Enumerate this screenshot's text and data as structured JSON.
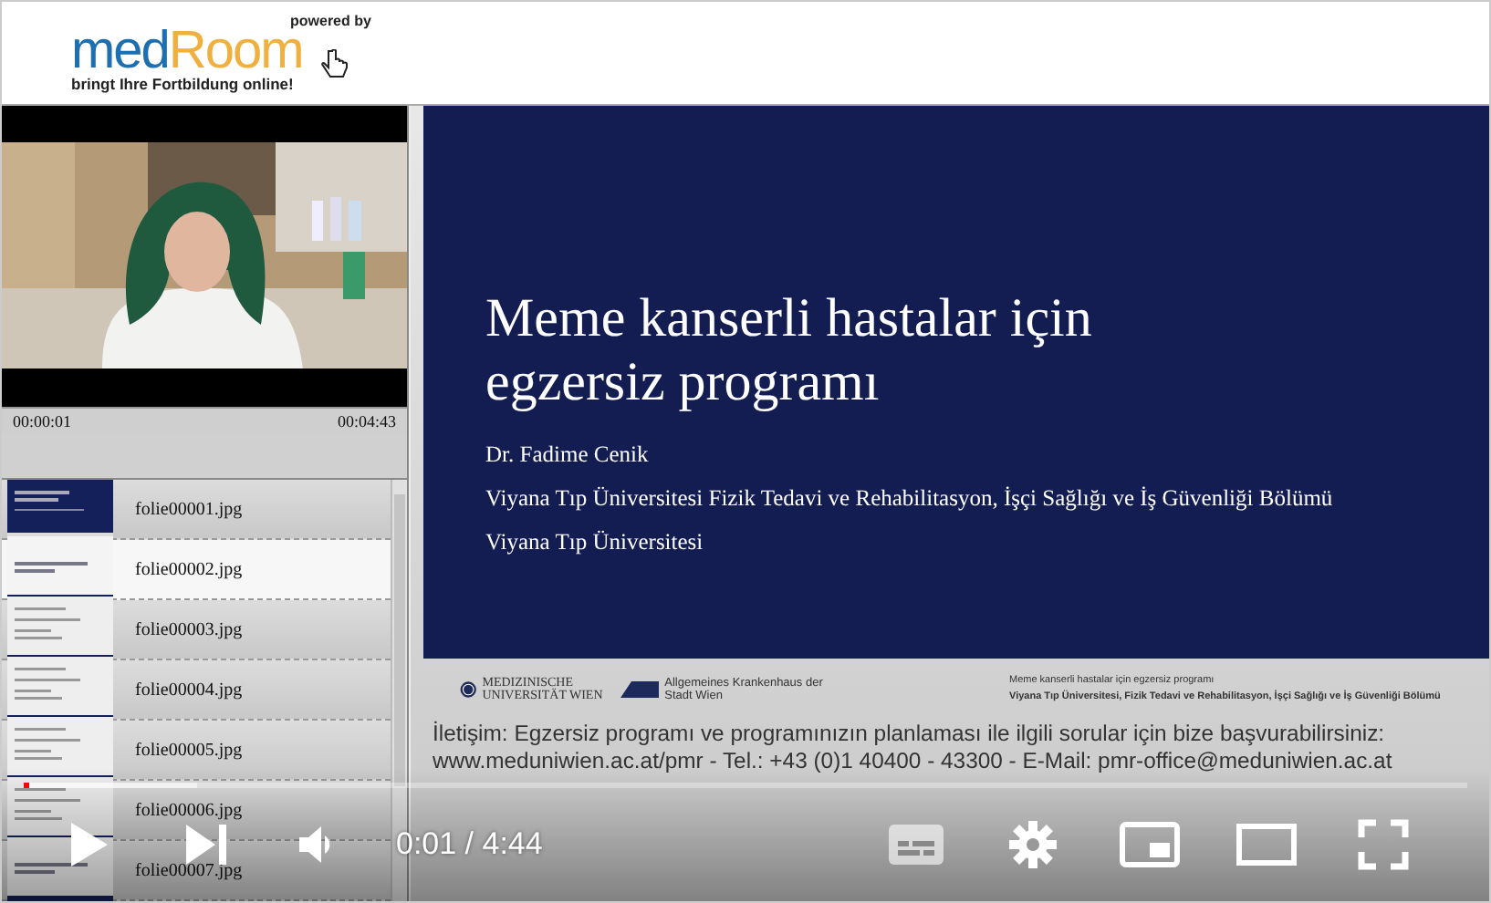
{
  "header": {
    "logo": {
      "brand_a": "med",
      "brand_b": "Room",
      "powered": "powered by",
      "tagline": "bringt Ihre Fortbildung online!"
    }
  },
  "sidebar": {
    "time_start": "00:00:01",
    "time_end": "00:04:43",
    "slides": [
      {
        "label": "folie00001.jpg",
        "selected": false,
        "kind": "title"
      },
      {
        "label": "folie00002.jpg",
        "selected": true,
        "kind": "heading"
      },
      {
        "label": "folie00003.jpg",
        "selected": false,
        "kind": "list"
      },
      {
        "label": "folie00004.jpg",
        "selected": false,
        "kind": "list"
      },
      {
        "label": "folie00005.jpg",
        "selected": false,
        "kind": "list"
      },
      {
        "label": "folie00006.jpg",
        "selected": false,
        "kind": "list"
      },
      {
        "label": "folie00007.jpg",
        "selected": false,
        "kind": "heading"
      }
    ]
  },
  "slide": {
    "title": "Meme kanserli hastalar için egzersiz programı",
    "author": "Dr. Fadime Cenik",
    "department": "Viyana Tıp Üniversitesi Fizik Tedavi ve Rehabilitasyon, İşçi Sağlığı ve İş Güvenliği Bölümü",
    "institution": "Viyana Tıp Üniversitesi",
    "footer": {
      "logo_1": "MEDIZINISCHE UNIVERSITÄT WIEN",
      "logo_2": "Allgemeines Krankenhaus der Stadt Wien",
      "caption_1": "Meme kanserli hastalar için egzersiz programı",
      "caption_2": "Viyana Tıp Üniversitesi, Fizik Tedavi ve Rehabilitasyon, İşçi Sağlığı ve İş Güvenliği Bölümü"
    },
    "contact": [
      "İletişim: Egzersiz programı ve programınızın planlaması ile ilgili sorular için bize başvurabilirsiniz:",
      "www.meduniwien.ac.at/pmr - Tel.: +43 (0)1 40400 - 43300 - E-Mail: pmr-office@meduniwien.ac.at"
    ]
  },
  "player": {
    "progress": {
      "level": 0.004
    },
    "time": "0:01 / 4:44"
  }
}
